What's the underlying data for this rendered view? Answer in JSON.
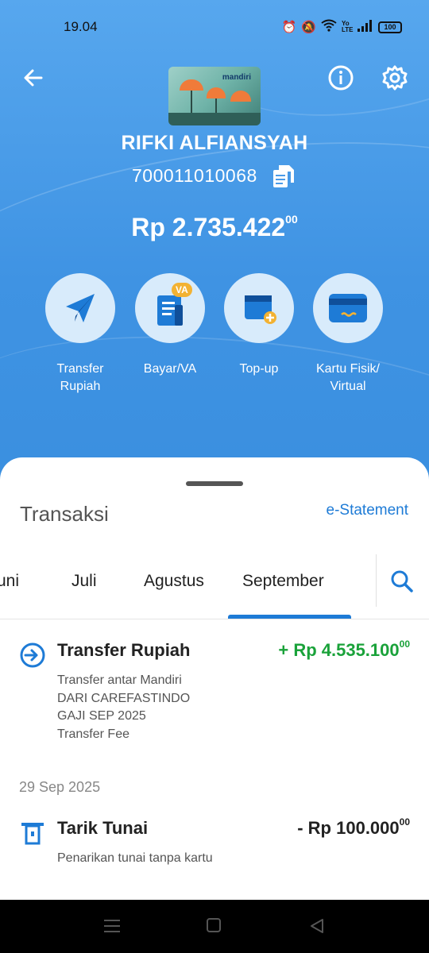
{
  "status": {
    "time": "19.04",
    "battery": "100",
    "network": "Yo LTE"
  },
  "account": {
    "name": "RIFKI ALFIANSYAH",
    "number": "700011010068",
    "balance_main": "Rp 2.735.422",
    "balance_cents": "00",
    "card_brand": "mandiri"
  },
  "actions": [
    {
      "label1": "Transfer",
      "label2": "Rupiah",
      "icon": "send-icon"
    },
    {
      "label1": "Bayar/VA",
      "label2": "",
      "icon": "bill-va-icon",
      "badge": "VA"
    },
    {
      "label1": "Top-up",
      "label2": "",
      "icon": "wallet-topup-icon"
    },
    {
      "label1": "Kartu Fisik/",
      "label2": "Virtual",
      "icon": "card-icon"
    }
  ],
  "transactions_header": {
    "title": "Transaksi",
    "estatement": "e-Statement"
  },
  "tabs": [
    "uni",
    "Juli",
    "Agustus",
    "September"
  ],
  "active_tab": "September",
  "transactions": [
    {
      "title": "Transfer Rupiah",
      "amount": "+ Rp 4.535.100",
      "cents": "00",
      "color": "#1aa23a",
      "desc": [
        "Transfer antar Mandiri",
        "DARI CAREFASTINDO",
        "GAJI SEP 2025",
        "Transfer Fee"
      ]
    },
    {
      "date": "29 Sep 2025",
      "title": "Tarik Tunai",
      "amount": "- Rp 100.000",
      "cents": "00",
      "color": "#222222",
      "desc": [
        "Penarikan tunai tanpa kartu"
      ]
    }
  ],
  "colors": {
    "primary": "#1e7bd6",
    "hero": "#4a9be8",
    "credit": "#1aa23a"
  }
}
